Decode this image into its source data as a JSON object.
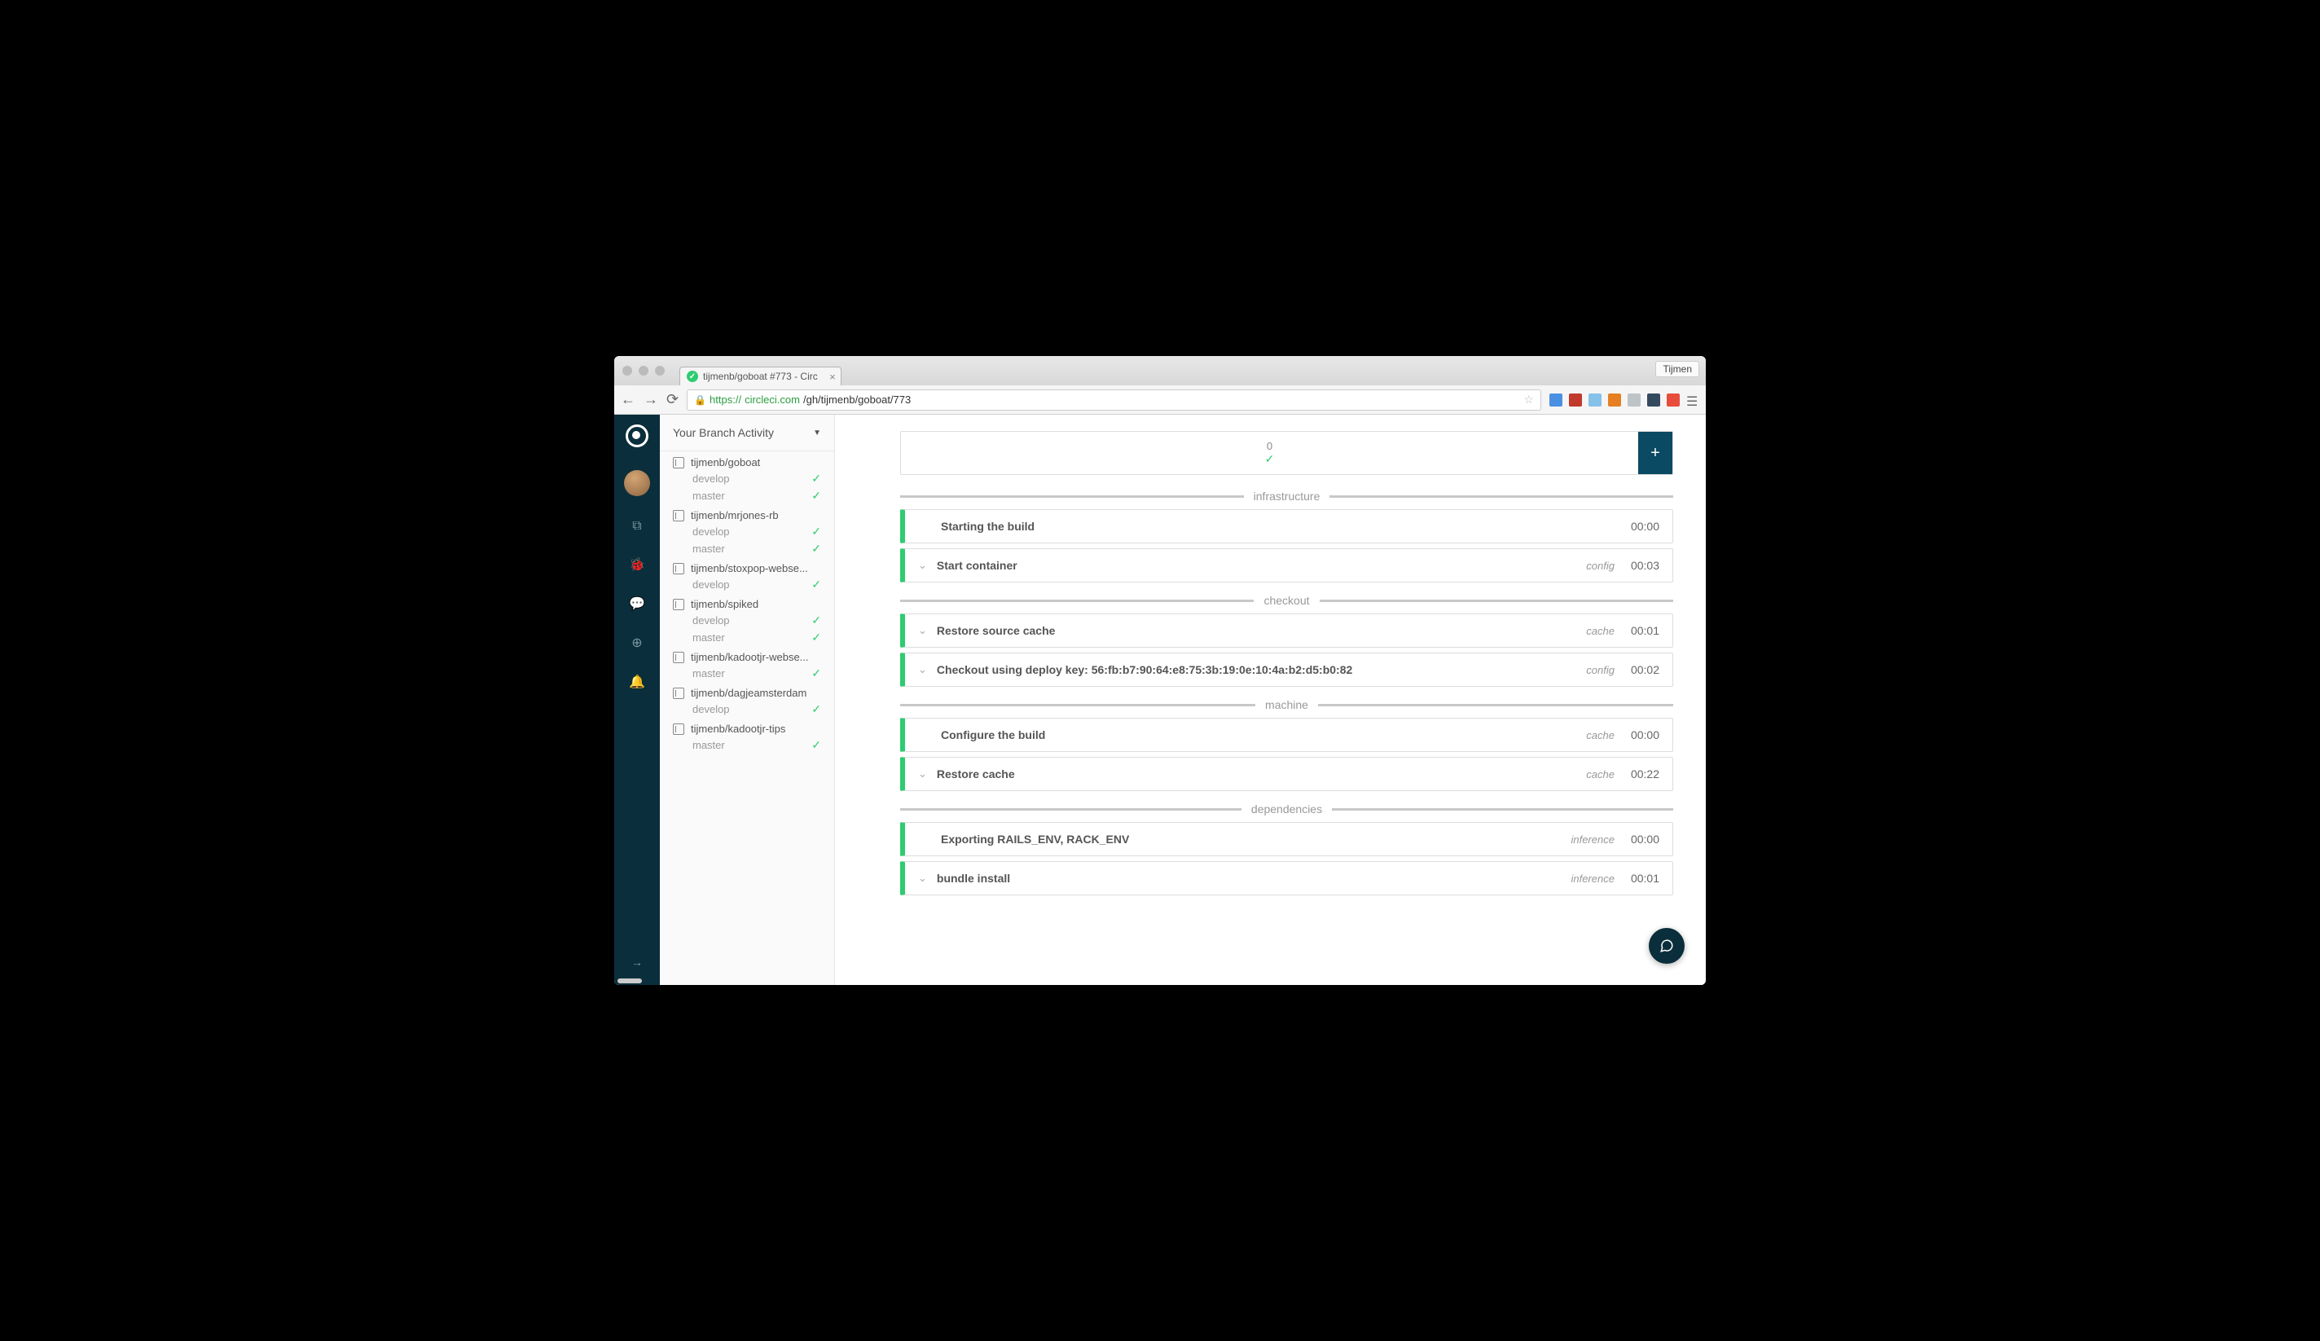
{
  "browser": {
    "tab_title": "tijmenb/goboat #773 - Circ",
    "profile_name": "Tijmen",
    "url_scheme": "https://",
    "url_host": "circleci.com",
    "url_path": "/gh/tijmenb/goboat/773"
  },
  "sidebar": {
    "header": "Your Branch Activity",
    "repos": [
      {
        "name": "tijmenb/goboat",
        "branches": [
          {
            "name": "develop"
          },
          {
            "name": "master"
          }
        ]
      },
      {
        "name": "tijmenb/mrjones-rb",
        "branches": [
          {
            "name": "develop"
          },
          {
            "name": "master"
          }
        ]
      },
      {
        "name": "tijmenb/stoxpop-webse...",
        "branches": [
          {
            "name": "develop"
          }
        ]
      },
      {
        "name": "tijmenb/spiked",
        "branches": [
          {
            "name": "develop"
          },
          {
            "name": "master"
          }
        ]
      },
      {
        "name": "tijmenb/kadootjr-webse...",
        "branches": [
          {
            "name": "master"
          }
        ]
      },
      {
        "name": "tijmenb/dagjeamsterdam",
        "branches": [
          {
            "name": "develop"
          }
        ]
      },
      {
        "name": "tijmenb/kadootjr-tips",
        "branches": [
          {
            "name": "master"
          }
        ]
      }
    ]
  },
  "containers": {
    "count": "0"
  },
  "sections": [
    {
      "label": "infrastructure",
      "steps": [
        {
          "title": "Starting the build",
          "tag": "",
          "time": "00:00",
          "expandable": false
        },
        {
          "title": "Start container",
          "tag": "config",
          "time": "00:03",
          "expandable": true
        }
      ]
    },
    {
      "label": "checkout",
      "steps": [
        {
          "title": "Restore source cache",
          "tag": "cache",
          "time": "00:01",
          "expandable": true
        },
        {
          "title": "Checkout using deploy key: 56:fb:b7:90:64:e8:75:3b:19:0e:10:4a:b2:d5:b0:82",
          "tag": "config",
          "time": "00:02",
          "expandable": true
        }
      ]
    },
    {
      "label": "machine",
      "steps": [
        {
          "title": "Configure the build",
          "tag": "cache",
          "time": "00:00",
          "expandable": false
        },
        {
          "title": "Restore cache",
          "tag": "cache",
          "time": "00:22",
          "expandable": true
        }
      ]
    },
    {
      "label": "dependencies",
      "steps": [
        {
          "title": "Exporting RAILS_ENV, RACK_ENV",
          "tag": "inference",
          "time": "00:00",
          "expandable": false
        },
        {
          "title": "bundle install",
          "tag": "inference",
          "time": "00:01",
          "expandable": true
        }
      ]
    }
  ]
}
